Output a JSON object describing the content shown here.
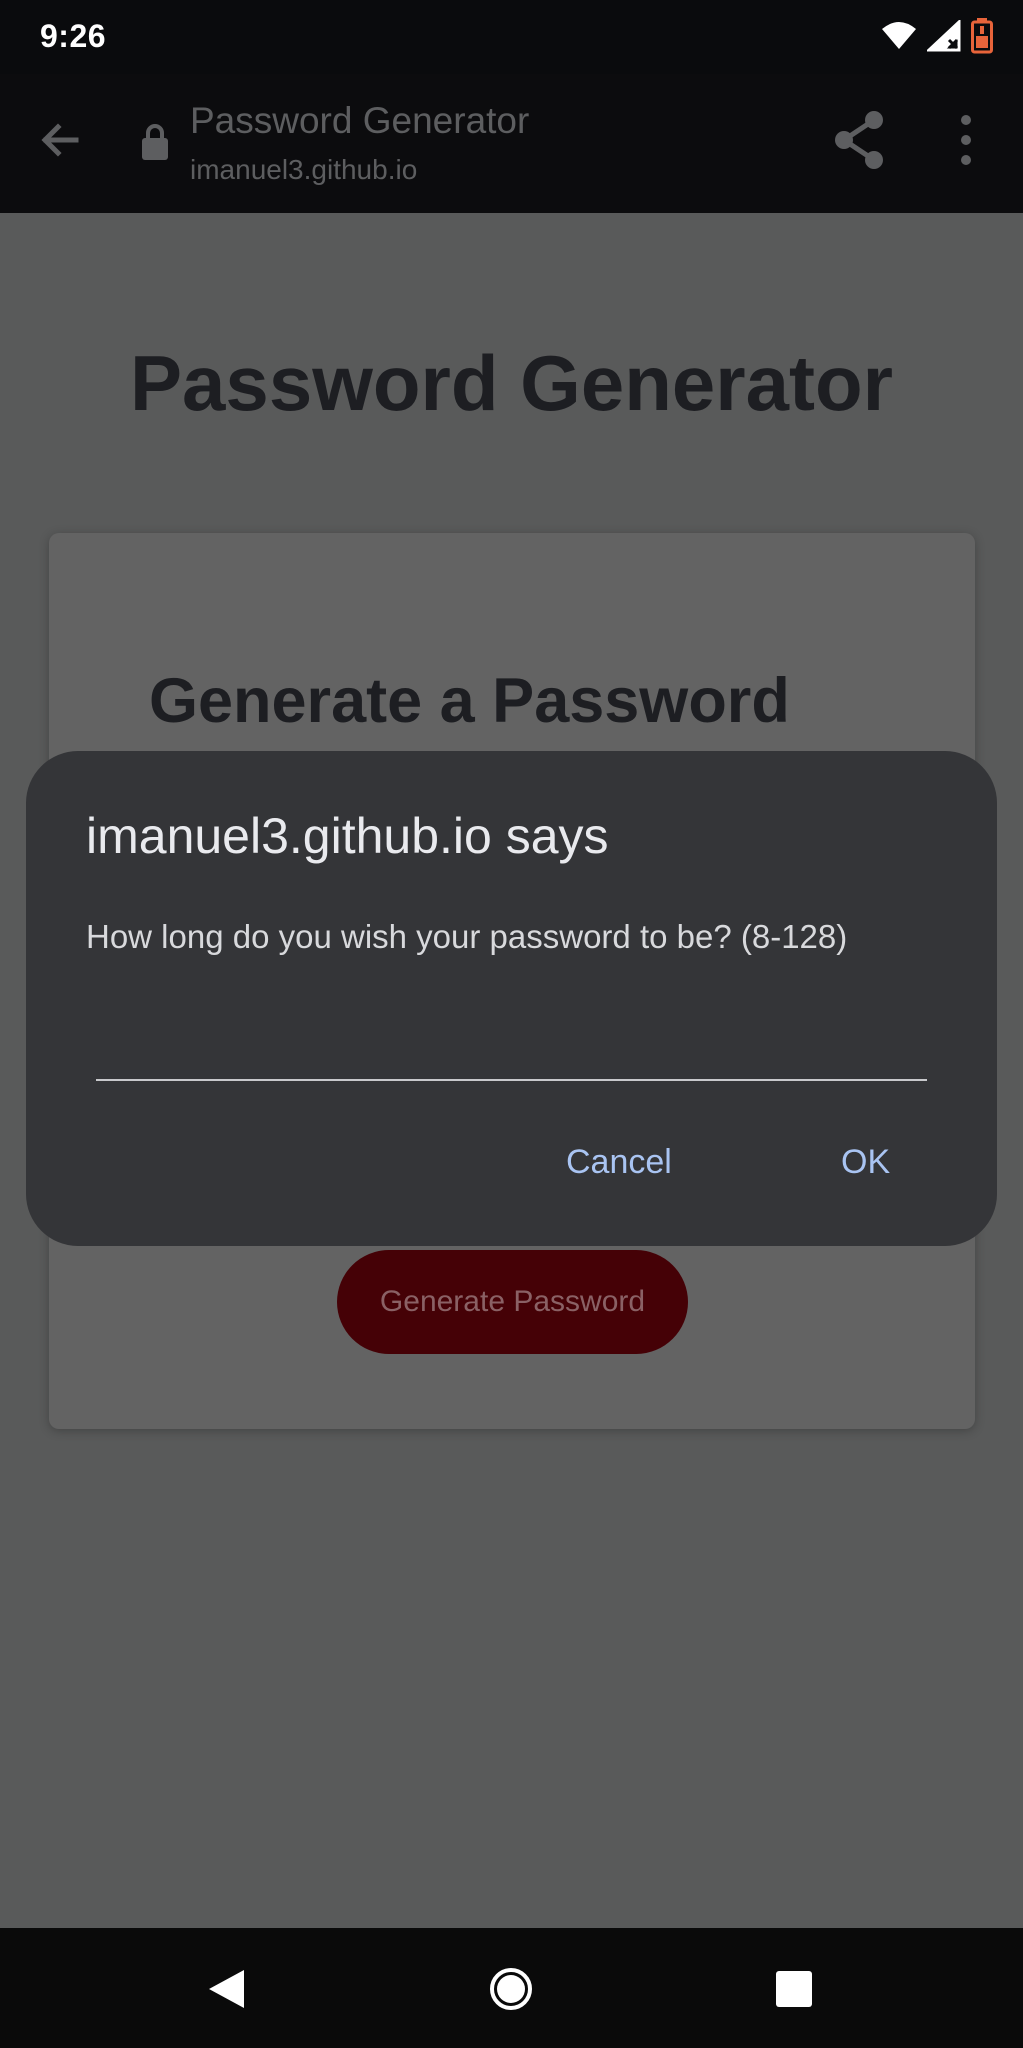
{
  "status_bar": {
    "time": "9:26",
    "icons": [
      "wifi-icon",
      "signal-icon",
      "battery-icon"
    ],
    "battery_color": "#e8643a"
  },
  "toolbar": {
    "title": "Password Generator",
    "url": "imanuel3.github.io",
    "icons": [
      "back-arrow-icon",
      "lock-icon",
      "share-icon",
      "more-vert-icon"
    ]
  },
  "page": {
    "heading": "Password Generator",
    "card_heading": "Generate a Password",
    "generate_button_label": "Generate Password",
    "accent_color": "#450106"
  },
  "dialog": {
    "title": "imanuel3.github.io says",
    "message": "How long do you wish your password to be? (8-128)",
    "input_value": "",
    "cancel_label": "Cancel",
    "ok_label": "OK",
    "button_color": "#a9c4f2"
  },
  "nav_bar": {
    "icons": [
      "nav-back-icon",
      "nav-home-icon",
      "nav-recents-icon"
    ]
  }
}
